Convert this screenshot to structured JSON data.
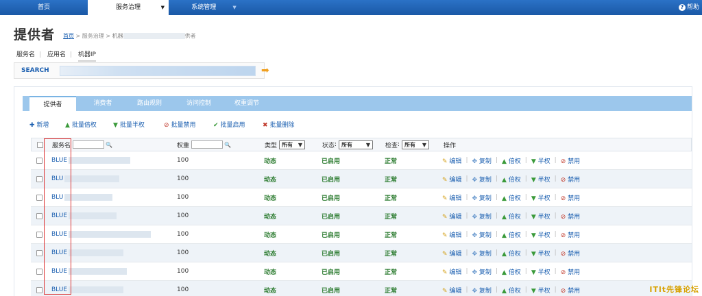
{
  "topnav": {
    "home": "首页",
    "governance": "服务治理",
    "system": "系统管理",
    "help": "帮助"
  },
  "header": {
    "title": "提供者",
    "breadcrumb_home": "首页",
    "breadcrumb_rest": " > 服务治理 > 机器",
    "breadcrumb_tail": "供者"
  },
  "subtabs": [
    "服务名",
    "应用名",
    "机器IP"
  ],
  "search": {
    "label": "SEARCH",
    "value": ""
  },
  "tabs": [
    "提供者",
    "消费者",
    "路由规则",
    "访问控制",
    "权重调节"
  ],
  "toolbar": [
    {
      "icon": "✚",
      "label": "新增",
      "color": "#1b5fb0"
    },
    {
      "icon": "▲",
      "label": "批量倍权",
      "color": "#3a9a3a"
    },
    {
      "icon": "▼",
      "label": "批量半权",
      "color": "#3a9a3a"
    },
    {
      "icon": "⊘",
      "label": "批量禁用",
      "color": "#c0392b"
    },
    {
      "icon": "✔",
      "label": "批量启用",
      "color": "#3a9a3a"
    },
    {
      "icon": "✖",
      "label": "批量删除",
      "color": "#c0392b"
    }
  ],
  "table": {
    "headers": {
      "service": "服务名",
      "weight": "权重",
      "type": "类型",
      "type_value": "所有",
      "status": "状态",
      "status_value": "所有",
      "check": "检查",
      "check_value": "所有",
      "ops": "操作"
    },
    "rows": [
      {
        "service": "BLUE",
        "weight": "100",
        "type": "动态",
        "status": "已启用",
        "check": "正常"
      },
      {
        "service": "BLU",
        "weight": "100",
        "type": "动态",
        "status": "已启用",
        "check": "正常"
      },
      {
        "service": "BLU",
        "weight": "100",
        "type": "动态",
        "status": "已启用",
        "check": "正常"
      },
      {
        "service": "BLUE",
        "weight": "100",
        "type": "动态",
        "status": "已启用",
        "check": "正常"
      },
      {
        "service": "BLUE",
        "weight": "100",
        "type": "动态",
        "status": "已启用",
        "check": "正常"
      },
      {
        "service": "BLUE",
        "weight": "100",
        "type": "动态",
        "status": "已启用",
        "check": "正常"
      },
      {
        "service": "BLUE",
        "weight": "100",
        "type": "动态",
        "status": "已启用",
        "check": "正常"
      },
      {
        "service": "BLUE",
        "weight": "100",
        "type": "动态",
        "status": "已启用",
        "check": "正常"
      }
    ],
    "ops": {
      "edit": "编辑",
      "copy": "复制",
      "double": "倍权",
      "half": "半权",
      "disable": "禁用"
    }
  },
  "watermark": "ITlt先锋论坛"
}
